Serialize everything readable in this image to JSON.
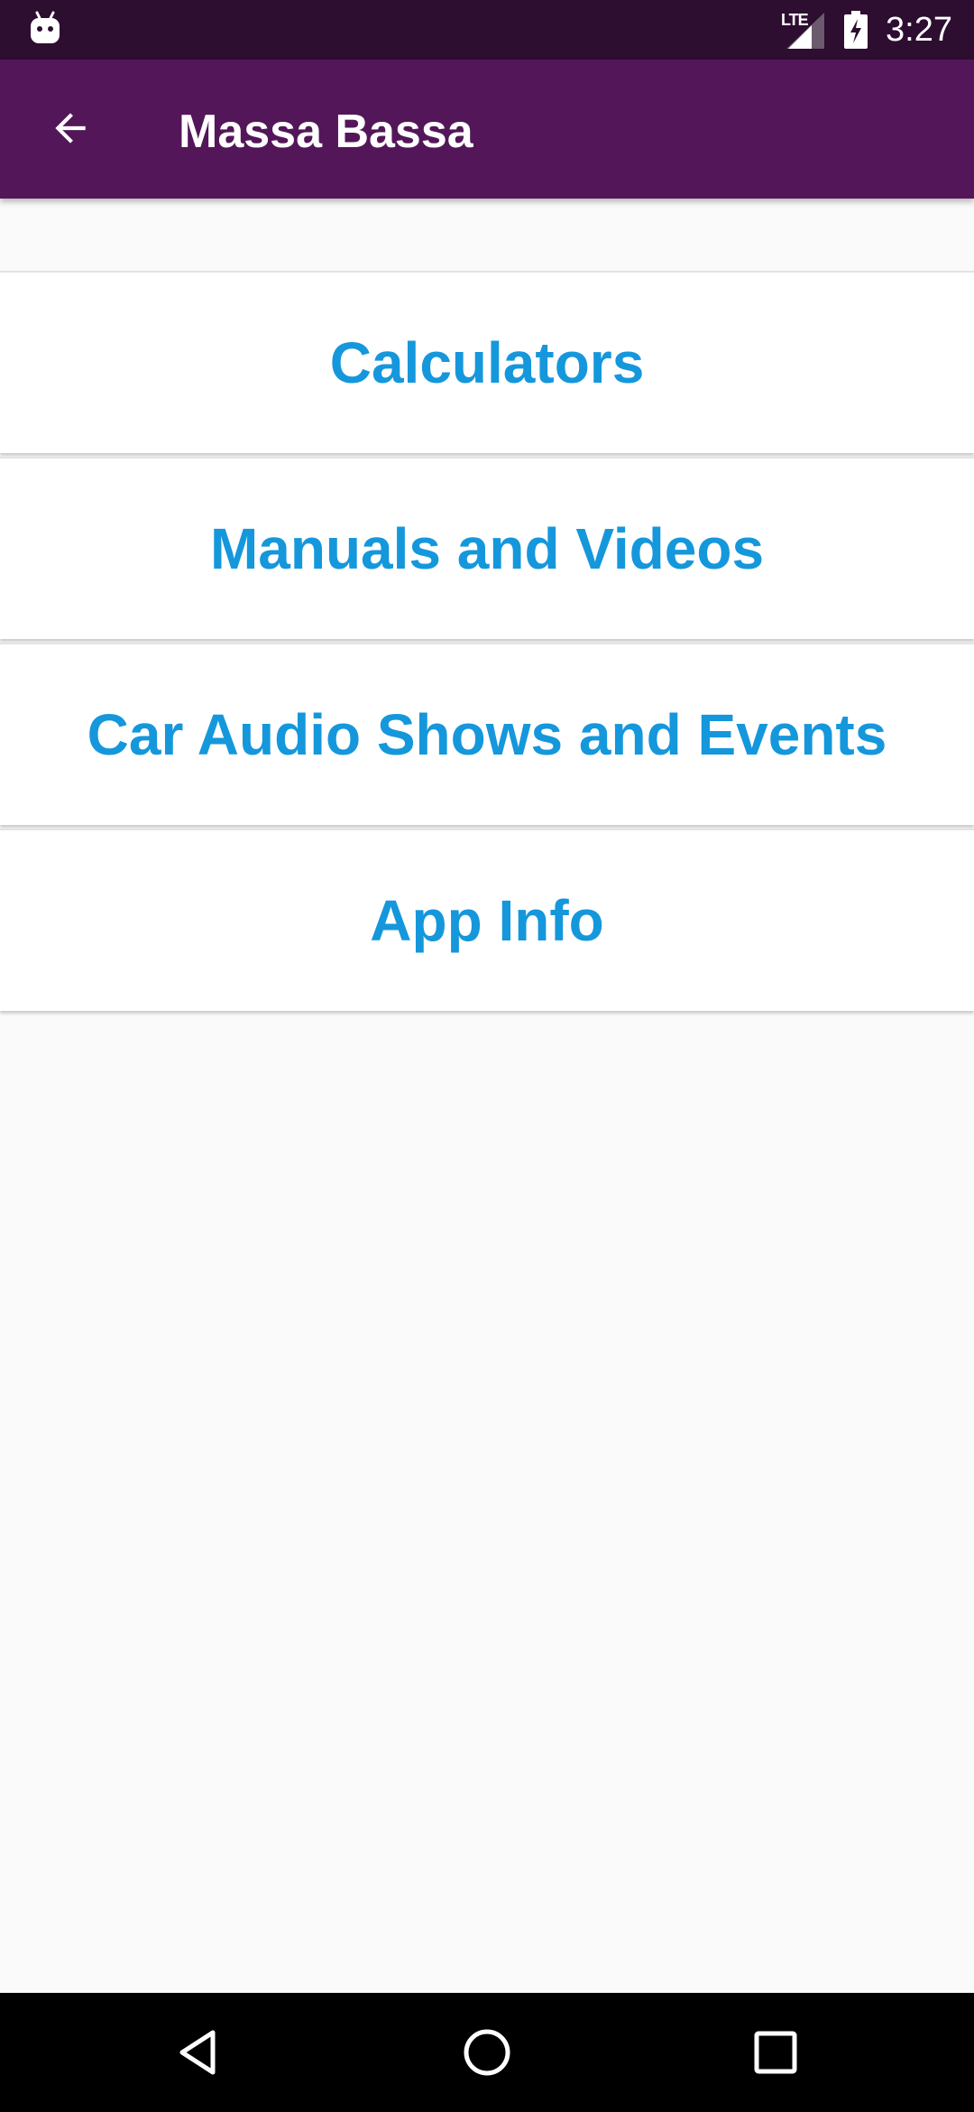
{
  "status_bar": {
    "network_label": "LTE",
    "time": "3:27",
    "icons": [
      "android-notification-icon",
      "signal-icon",
      "battery-charging-icon"
    ]
  },
  "app_bar": {
    "title": "Massa Bassa",
    "back_icon": "arrow-back-icon"
  },
  "menu": {
    "items": [
      {
        "label": "Calculators"
      },
      {
        "label": "Manuals and Videos"
      },
      {
        "label": "Car Audio Shows and Events"
      },
      {
        "label": "App Info"
      }
    ]
  },
  "nav_bar": {
    "icons": [
      "nav-back-icon",
      "nav-home-icon",
      "nav-recents-icon"
    ]
  },
  "colors": {
    "status_bar": "#2d0d30",
    "app_bar": "#531759",
    "accent_text": "#1597dc",
    "background": "#fafafa"
  }
}
